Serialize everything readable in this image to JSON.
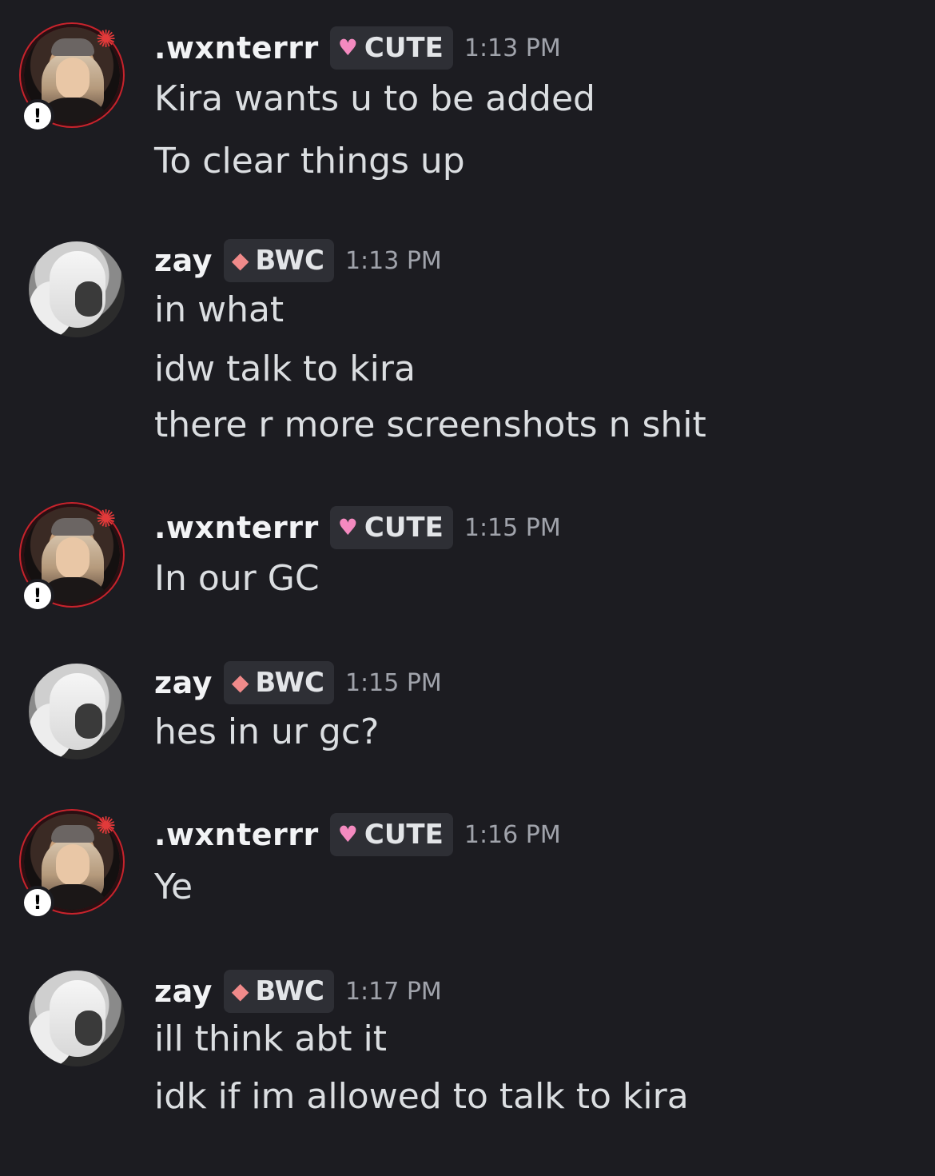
{
  "messages": [
    {
      "author": ".wxnterrr",
      "tag": "CUTE",
      "tag_icon": "pink-heart-icon",
      "time": "1:13 PM",
      "lines": [
        "Kira wants u to be added",
        "To clear things up"
      ]
    },
    {
      "author": "zay",
      "tag": "BWC",
      "tag_icon": "gem-icon",
      "time": "1:13 PM",
      "lines": [
        "in what",
        "idw talk to kira",
        "there r more screenshots n shit"
      ]
    },
    {
      "author": ".wxnterrr",
      "tag": "CUTE",
      "tag_icon": "pink-heart-icon",
      "time": "1:15 PM",
      "lines": [
        "In our GC"
      ]
    },
    {
      "author": "zay",
      "tag": "BWC",
      "tag_icon": "gem-icon",
      "time": "1:15 PM",
      "lines": [
        "hes in ur gc?"
      ]
    },
    {
      "author": ".wxnterrr",
      "tag": "CUTE",
      "tag_icon": "pink-heart-icon",
      "time": "1:16 PM",
      "lines": [
        "Ye"
      ]
    },
    {
      "author": "zay",
      "tag": "BWC",
      "tag_icon": "gem-icon",
      "time": "1:17 PM",
      "lines": [
        "ill think abt it",
        "idk if im allowed to talk to kira"
      ]
    }
  ],
  "colors": {
    "background": "#1c1c21",
    "username": "#f2f3f5",
    "text": "#dbdee1",
    "timestamp": "#a0a3ab",
    "tag_bg": "#2e2f35",
    "status_ring": "#c8232c"
  }
}
